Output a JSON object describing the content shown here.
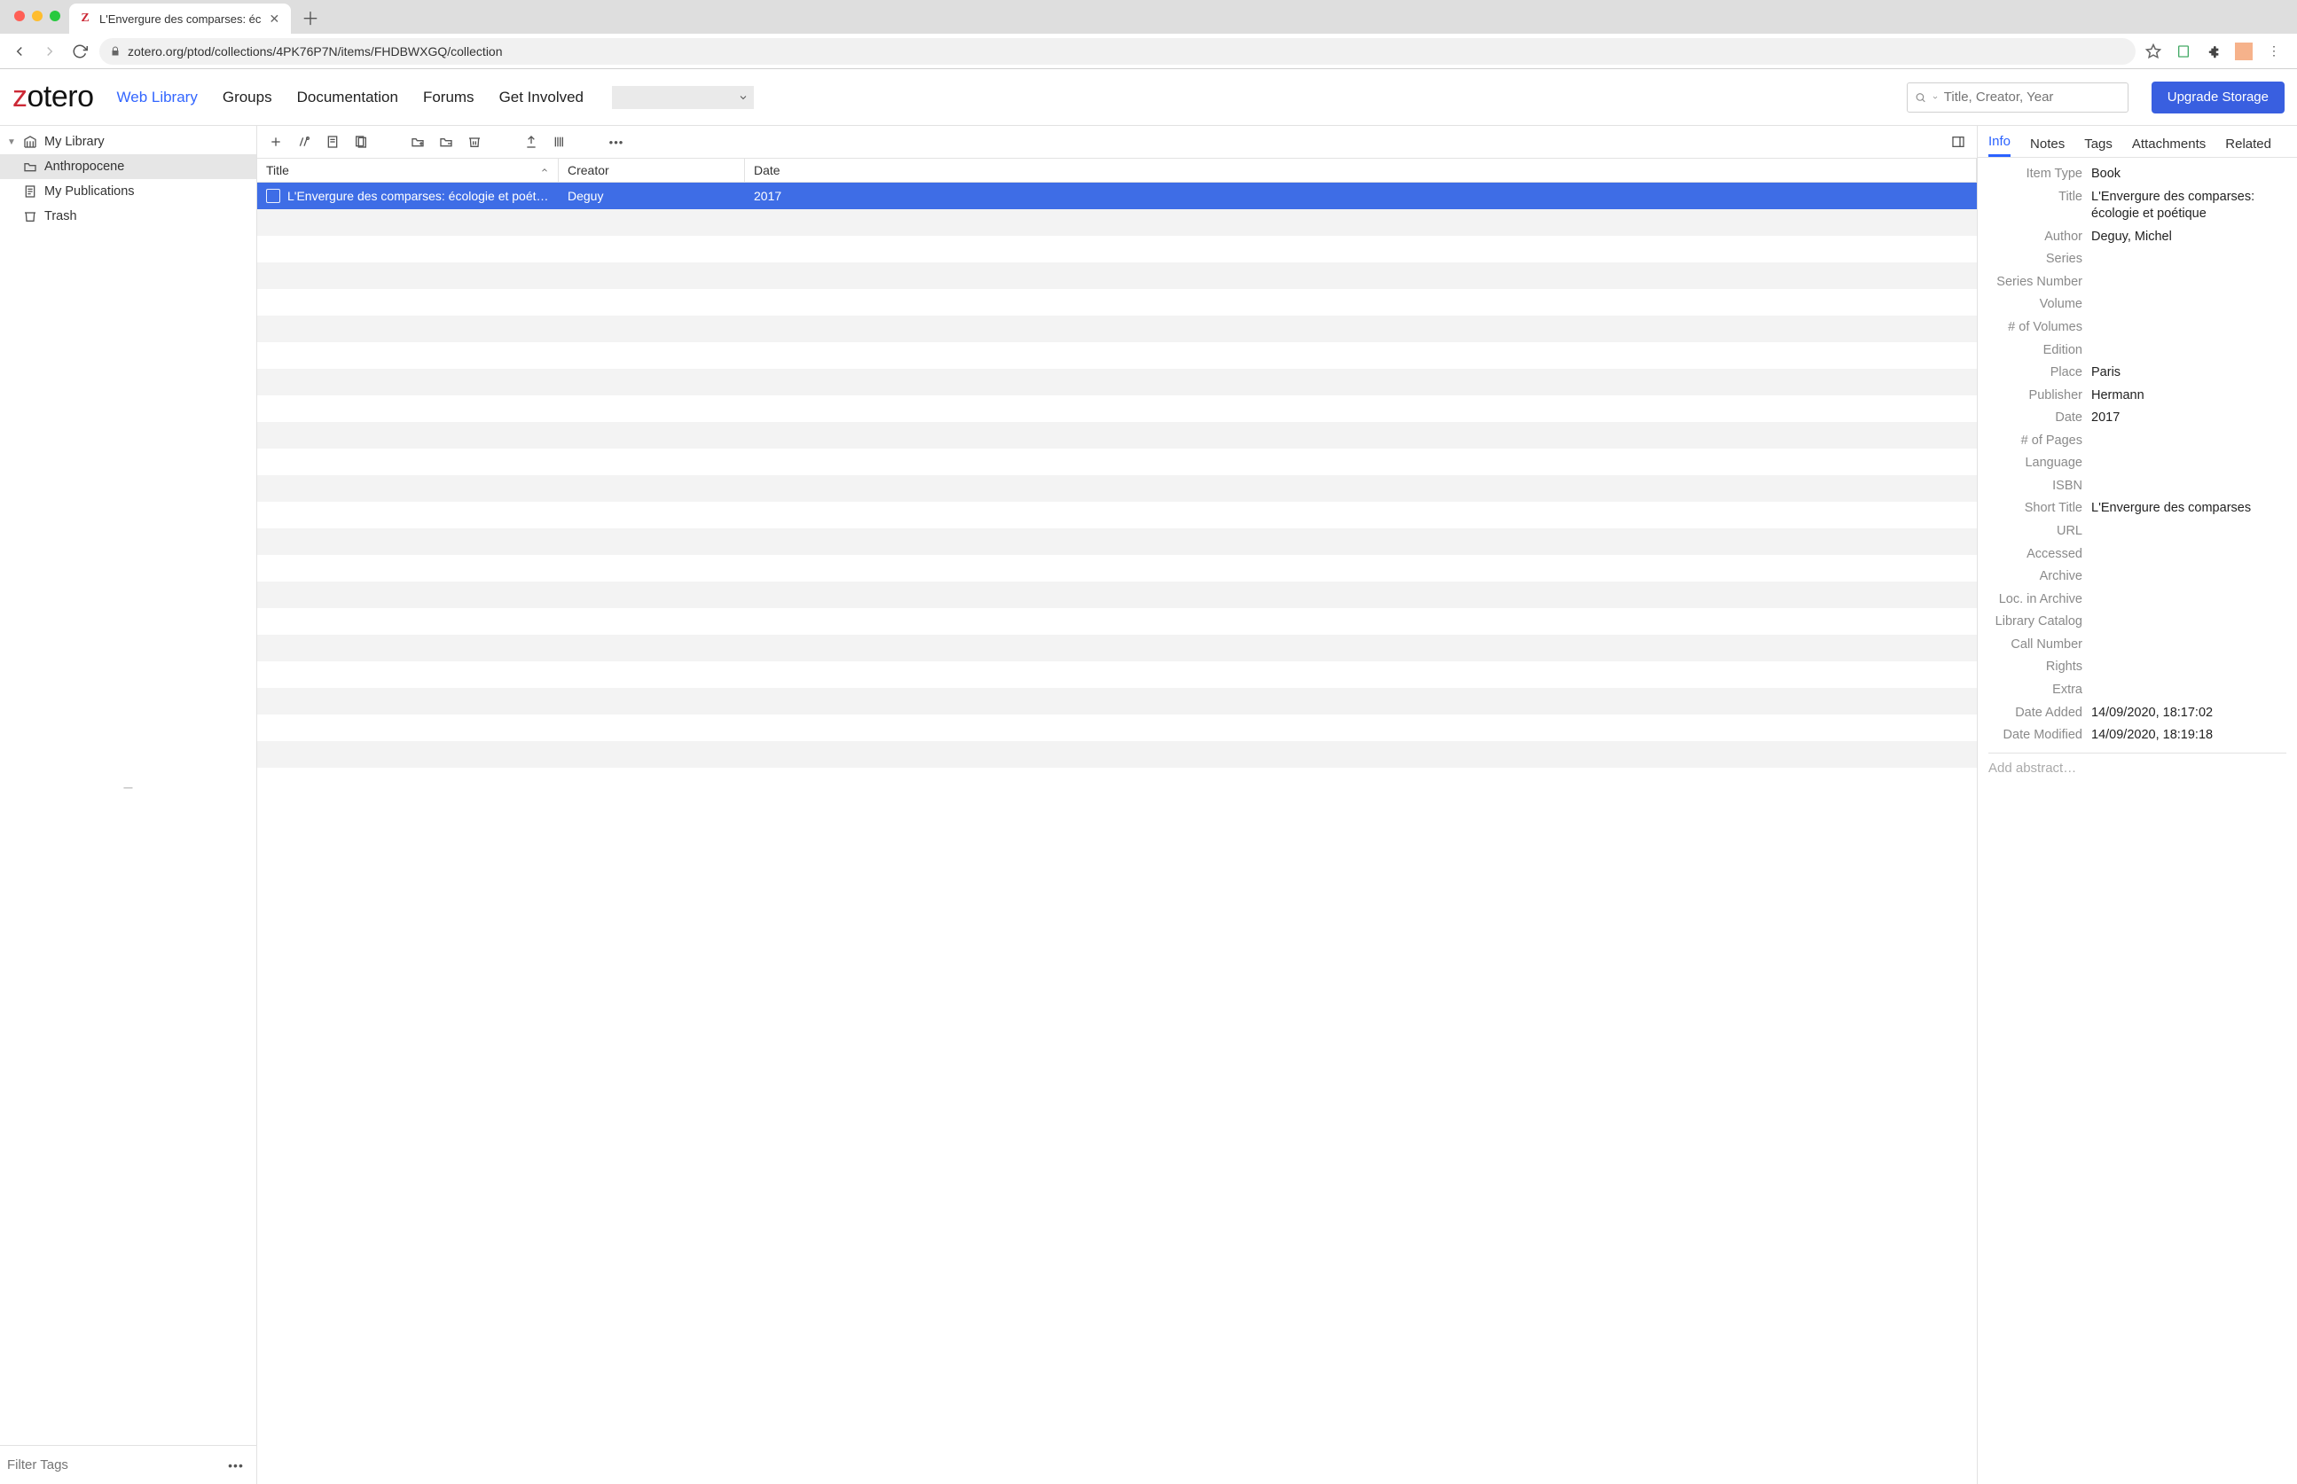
{
  "browser": {
    "tab_title": "L'Envergure des comparses: éc",
    "url": "zotero.org/ptod/collections/4PK76P7N/items/FHDBWXGQ/collection"
  },
  "header": {
    "logo_rest": "otero",
    "nav": [
      "Web Library",
      "Groups",
      "Documentation",
      "Forums",
      "Get Involved"
    ],
    "search_placeholder": "Title, Creator, Year",
    "upgrade": "Upgrade Storage"
  },
  "sidebar": {
    "library": "My Library",
    "items": [
      {
        "label": "Anthropocene",
        "selected": true,
        "icon": "folder"
      },
      {
        "label": "My Publications",
        "selected": false,
        "icon": "doc"
      },
      {
        "label": "Trash",
        "selected": false,
        "icon": "trash"
      }
    ],
    "filter_placeholder": "Filter Tags"
  },
  "columns": {
    "title": "Title",
    "creator": "Creator",
    "date": "Date"
  },
  "items": [
    {
      "title": "L'Envergure des comparses: écologie et poét…",
      "creator": "Deguy",
      "date": "2017",
      "selected": true
    }
  ],
  "right": {
    "tabs": [
      "Info",
      "Notes",
      "Tags",
      "Attachments",
      "Related"
    ],
    "fields": [
      {
        "label": "Item Type",
        "value": "Book"
      },
      {
        "label": "Title",
        "value": "L'Envergure des comparses: écologie et poétique"
      },
      {
        "label": "Author",
        "value": "Deguy, Michel"
      },
      {
        "label": "Series",
        "value": ""
      },
      {
        "label": "Series Number",
        "value": ""
      },
      {
        "label": "Volume",
        "value": ""
      },
      {
        "label": "# of Volumes",
        "value": ""
      },
      {
        "label": "Edition",
        "value": ""
      },
      {
        "label": "Place",
        "value": "Paris"
      },
      {
        "label": "Publisher",
        "value": "Hermann"
      },
      {
        "label": "Date",
        "value": "2017"
      },
      {
        "label": "# of Pages",
        "value": ""
      },
      {
        "label": "Language",
        "value": ""
      },
      {
        "label": "ISBN",
        "value": ""
      },
      {
        "label": "Short Title",
        "value": "L'Envergure des comparses"
      },
      {
        "label": "URL",
        "value": ""
      },
      {
        "label": "Accessed",
        "value": ""
      },
      {
        "label": "Archive",
        "value": ""
      },
      {
        "label": "Loc. in Archive",
        "value": ""
      },
      {
        "label": "Library Catalog",
        "value": ""
      },
      {
        "label": "Call Number",
        "value": ""
      },
      {
        "label": "Rights",
        "value": ""
      },
      {
        "label": "Extra",
        "value": ""
      },
      {
        "label": "Date Added",
        "value": "14/09/2020, 18:17:02"
      },
      {
        "label": "Date Modified",
        "value": "14/09/2020, 18:19:18"
      }
    ],
    "abstract_placeholder": "Add abstract…"
  }
}
